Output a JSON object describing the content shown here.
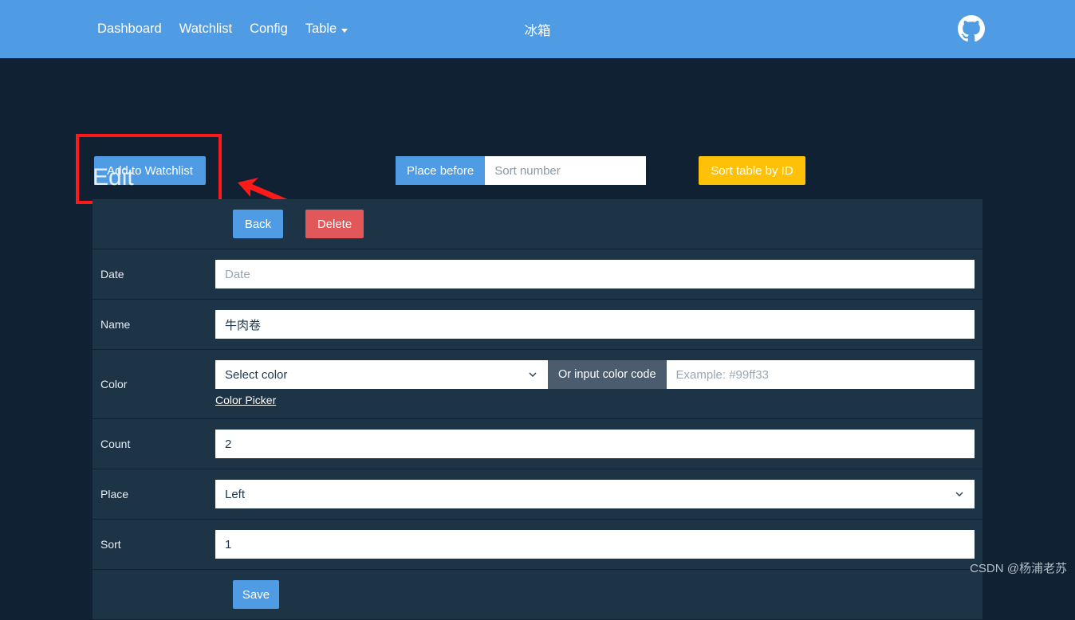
{
  "navbar": {
    "links": [
      {
        "label": "Dashboard",
        "name": "nav-link-dashboard"
      },
      {
        "label": "Watchlist",
        "name": "nav-link-watchlist"
      },
      {
        "label": "Config",
        "name": "nav-link-config"
      }
    ],
    "dropdown_label": "Table",
    "title": "冰箱",
    "github_icon": "github-icon",
    "bg_color": "#4f9ce4"
  },
  "toolbar": {
    "add_to_watchlist_label": "Add to Watchlist",
    "place_before_label": "Place before",
    "sort_number_placeholder": "Sort number",
    "sort_number_value": "",
    "sort_table_by_id_label": "Sort table by ID",
    "annotation_color": "#ff1a1a"
  },
  "main": {
    "page_title": "Edit",
    "actions": {
      "back_label": "Back",
      "delete_label": "Delete",
      "save_label": "Save"
    },
    "fields": {
      "date": {
        "label": "Date",
        "placeholder": "Date",
        "value": ""
      },
      "name": {
        "label": "Name",
        "placeholder": "",
        "value": "牛肉卷"
      },
      "color": {
        "label": "Color",
        "select_value": "Select color",
        "addon_label": "Or input color code",
        "code_placeholder": "Example: #99ff33",
        "code_value": "",
        "picker_link_label": "Color Picker"
      },
      "count": {
        "label": "Count",
        "placeholder": "",
        "value": "2"
      },
      "place": {
        "label": "Place",
        "select_value": "Left"
      },
      "sort": {
        "label": "Sort",
        "placeholder": "",
        "value": "1"
      }
    }
  },
  "watermark": "CSDN @杨浦老苏"
}
